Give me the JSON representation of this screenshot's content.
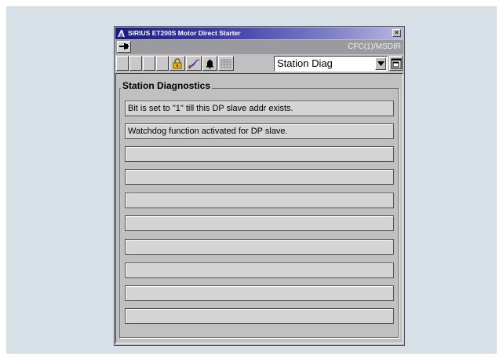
{
  "window": {
    "title": "SIRIUS ET200S Motor Direct Starter",
    "close_glyph": "×",
    "icons": {
      "app": "siemens-faceplate-icon",
      "close": "close-icon",
      "pin": "pin-icon"
    }
  },
  "pathbar": {
    "path": "CFC(1)/MSDIR"
  },
  "toolbar": {
    "buttons": [
      {
        "icon": "blank-icon"
      },
      {
        "icon": "blank-icon"
      },
      {
        "icon": "blank-icon"
      },
      {
        "icon": "blank-icon"
      },
      {
        "icon": "lock-icon"
      },
      {
        "icon": "pen-signature-icon"
      },
      {
        "icon": "bell-icon"
      },
      {
        "icon": "grid-icon"
      }
    ],
    "view_select": {
      "value": "Station Diag"
    },
    "restore_icon": "restore-icon"
  },
  "panel": {
    "group_title": "Station Diagnostics",
    "rows": [
      "Bit is set to \"1\" till this DP slave addr exists.",
      "Watchdog function activated for DP slave.",
      "",
      "",
      "",
      "",
      "",
      "",
      "",
      ""
    ]
  },
  "colors": {
    "titlebar_start": "#1a1a80",
    "titlebar_end": "#b8b8e0",
    "window_bg": "#c0c0c0",
    "backdrop": "#d7dfe7",
    "lock_accent": "#e8b400"
  }
}
